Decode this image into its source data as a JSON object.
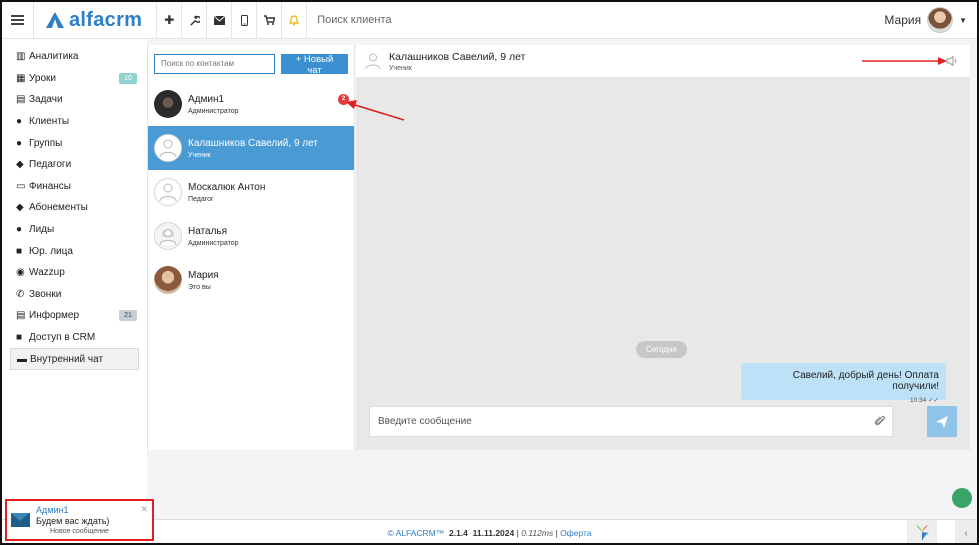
{
  "topbar": {
    "logo": "alfacrm",
    "search_placeholder": "Поиск клиента",
    "user_name": "Мария",
    "icons": [
      "plus-icon",
      "wrench-icon",
      "mail-icon",
      "phone-icon",
      "cart-icon",
      "bell-icon"
    ]
  },
  "sidebar": {
    "items": [
      {
        "label": "Аналитика",
        "icon": "chart-icon"
      },
      {
        "label": "Уроки",
        "icon": "calendar-icon",
        "badge": "10"
      },
      {
        "label": "Задачи",
        "icon": "tasks-icon"
      },
      {
        "label": "Клиенты",
        "icon": "user-icon"
      },
      {
        "label": "Группы",
        "icon": "users-icon"
      },
      {
        "label": "Педагоги",
        "icon": "graduation-cap-icon"
      },
      {
        "label": "Финансы",
        "icon": "money-icon"
      },
      {
        "label": "Абонементы",
        "icon": "tag-icon"
      },
      {
        "label": "Лиды",
        "icon": "user-plus-icon"
      },
      {
        "label": "Юр. лица",
        "icon": "briefcase-icon"
      },
      {
        "label": "Wazzup",
        "icon": "whatsapp-icon"
      },
      {
        "label": "Звонки",
        "icon": "phone-icon"
      },
      {
        "label": "Информер",
        "icon": "list-icon",
        "badge": "21"
      },
      {
        "label": "Доступ в CRM",
        "icon": "lock-icon"
      },
      {
        "label": "Внутренний чат",
        "icon": "chat-icon"
      }
    ]
  },
  "contacts": {
    "search_placeholder": "Поиск по контактам",
    "new_chat_label": "+ Новый чат",
    "list": [
      {
        "name": "Админ1",
        "role": "Администратор",
        "unread": "2"
      },
      {
        "name": "Калашников Савелий, 9 лет",
        "role": "Ученик"
      },
      {
        "name": "Москалюк Антон",
        "role": "Педагог"
      },
      {
        "name": "Наталья",
        "role": "Администратор"
      },
      {
        "name": "Мария",
        "role": "Это вы"
      }
    ]
  },
  "chat": {
    "title": "Калашников Савелий, 9 лет",
    "subtitle": "Ученик",
    "date_divider": "Сегодня",
    "messages": [
      {
        "text": "Савелий, добрый день! Оплата получили!",
        "time": "10:34"
      }
    ],
    "input_placeholder": "Введите сообщение"
  },
  "footer": {
    "brand": "© ALFACRM™",
    "version": "2.1.4",
    "date": "11.11.2024",
    "sep1": "|",
    "timing": "0.112ms",
    "sep2": "|",
    "offer_link": "Оферта"
  },
  "toast": {
    "sender": "Админ1",
    "message": "Будем вас ждать)",
    "subtitle": "Новое сообщение"
  },
  "colors": {
    "accent": "#2d7fc6",
    "selected": "#4a9ad4",
    "bubble": "#bde1f7",
    "annotation": "#e02020"
  }
}
